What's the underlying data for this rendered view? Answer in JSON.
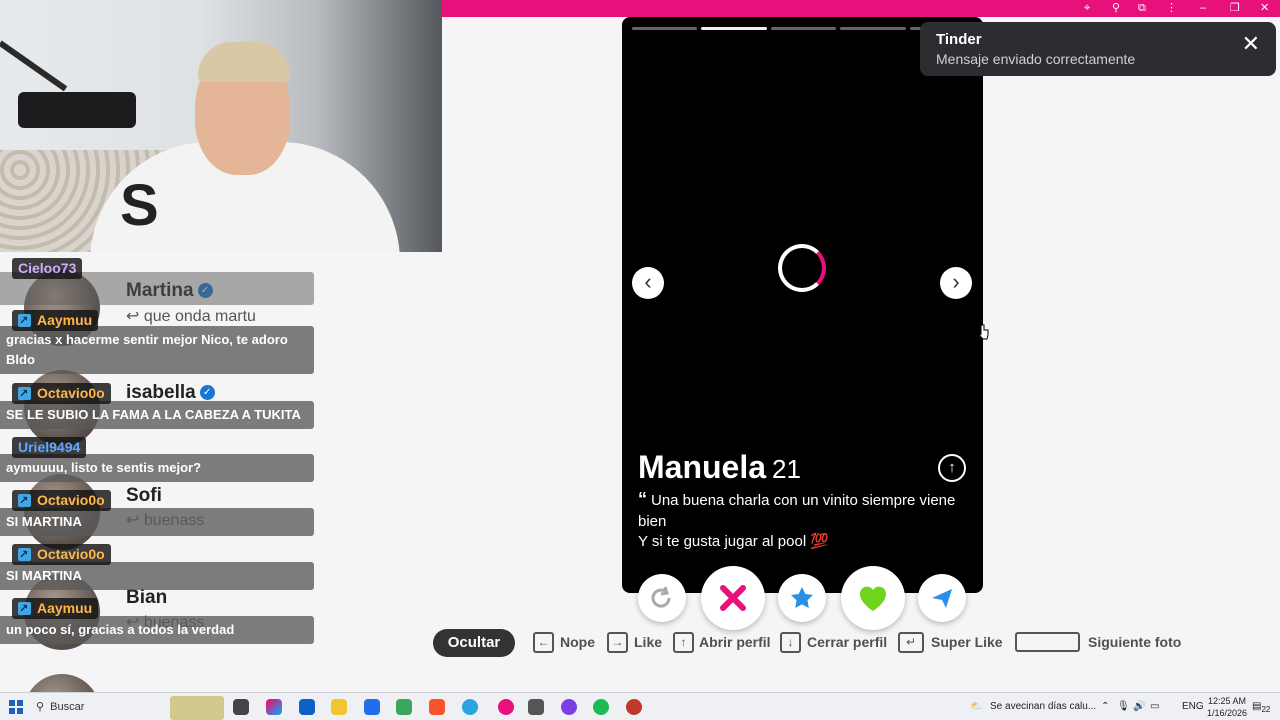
{
  "colors": {
    "brand": "#e8117c",
    "toast_bg": "#2b2d31",
    "chat_msg_bg": "#5a5a5a",
    "card_bg": "#000000"
  },
  "browser": {
    "icons": [
      "location-icon",
      "zoom-icon",
      "extensions-icon",
      "menu-dots-icon",
      "minimize-icon",
      "restore-icon",
      "close-icon"
    ]
  },
  "toast": {
    "title": "Tinder",
    "message": "Mensaje enviado correctamente"
  },
  "profile": {
    "name": "Manuela",
    "age": "21",
    "bio_line1": "Una buena charla con un vinito siempre viene bien",
    "bio_line2": "Y si te gusta jugar al pool 💯",
    "photo_count": 5,
    "active_photo": 2
  },
  "chat_background": [
    {
      "name": "Martina",
      "reply": "que onda martu",
      "verified": true
    },
    {
      "name": "isabella",
      "reply": "",
      "verified": true
    },
    {
      "name": "Sofi",
      "reply": "buenass",
      "verified": false
    },
    {
      "name": "Bian",
      "reply": "buenass",
      "verified": false
    }
  ],
  "chat": [
    {
      "user": "Cieloo73",
      "color": "#d6a8ff",
      "badge": false,
      "text": ""
    },
    {
      "user": "Aaymuu",
      "color": "#ffb74d",
      "badge": true,
      "text": "gracias x hacerme sentir mejor Nico, te adoro Bldo"
    },
    {
      "user": "Octavio0o",
      "color": "#ffb74d",
      "badge": true,
      "text": "SE LE SUBIO LA FAMA A LA CABEZA A TUKITA"
    },
    {
      "user": "Uriel9494",
      "color": "#5fa8ff",
      "badge": false,
      "text": "aymuuuu, listo te sentis mejor?"
    },
    {
      "user": "Octavio0o",
      "color": "#ffb74d",
      "badge": true,
      "text": "SI MARTINA"
    },
    {
      "user": "Octavio0o",
      "color": "#ffb74d",
      "badge": true,
      "text": "SI MARTINA"
    },
    {
      "user": "Aaymuu",
      "color": "#ffb74d",
      "badge": true,
      "text": "un poco sí, gracias a todos la verdad"
    }
  ],
  "shortcuts": {
    "hide": "Ocultar",
    "nope": "Nope",
    "like": "Like",
    "open_profile": "Abrir perfil",
    "close_profile": "Cerrar perfil",
    "super_like": "Super Like",
    "next_photo": "Siguiente foto"
  },
  "taskbar": {
    "search_placeholder": "Buscar",
    "weather": "Se avecinan días calu...",
    "language": "ENG",
    "time": "12:25 AM",
    "date": "1/16/2026",
    "notifications": "22"
  }
}
